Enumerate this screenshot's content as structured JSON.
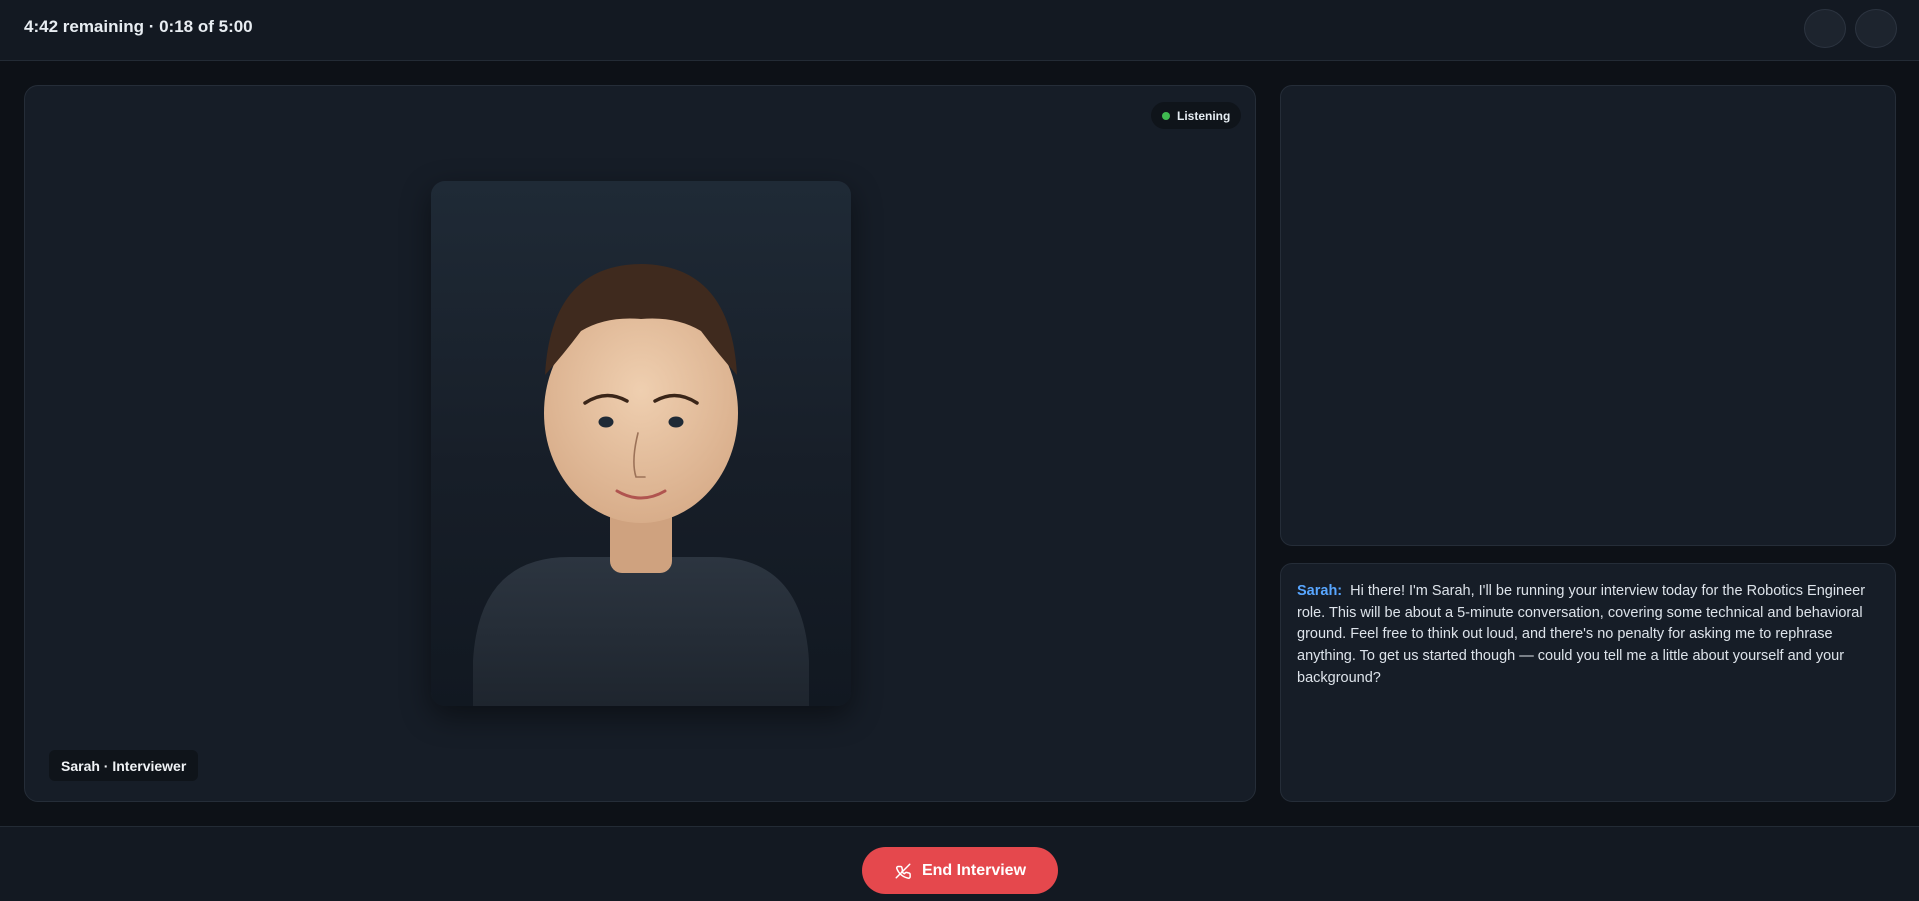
{
  "header": {
    "timer_text": "4:42 remaining · 0:18 of 5:00"
  },
  "stage": {
    "status_label": "Listening",
    "status_color": "#3fb950",
    "name_tag": "Sarah · Interviewer"
  },
  "transcript": {
    "speaker": "Sarah:",
    "message": "Hi there! I'm Sarah, I'll be running your interview today for the Robotics Engineer role. This will be about a 5-minute conversation, covering some technical and behavioral ground. Feel free to think out loud, and there's no penalty for asking me to rephrase anything. To get us started though — could you tell me a little about yourself and your background?"
  },
  "footer": {
    "end_label": "End Interview",
    "end_icon": "phone-off-icon",
    "end_color": "#e5484d"
  },
  "colors": {
    "background": "#0d1117",
    "panel": "#161d27",
    "accent": "#58a6ff"
  }
}
